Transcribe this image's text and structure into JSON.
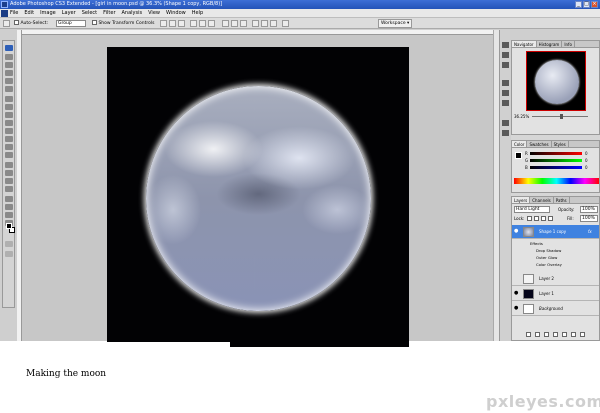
{
  "window": {
    "title": "Adobe Photoshop CS3 Extended - [girl in moon.psd @ 36.3% (Shape 1 copy, RGB/8)]"
  },
  "menu": [
    "File",
    "Edit",
    "Image",
    "Layer",
    "Select",
    "Filter",
    "Analysis",
    "View",
    "Window",
    "Help"
  ],
  "options": {
    "auto_select_label": "Auto-Select:",
    "auto_select_value": "Group",
    "show_transform_label": "Show Transform Controls",
    "workspace_label": "Workspace ▾"
  },
  "navigator": {
    "tabs": [
      "Navigator",
      "Histogram",
      "Info"
    ],
    "zoom": "36.25%"
  },
  "color_panel": {
    "tabs": [
      "Color",
      "Swatches",
      "Styles"
    ],
    "r_value": "0",
    "g_value": "0",
    "b_value": "0",
    "r_label": "R",
    "g_label": "G",
    "b_label": "B"
  },
  "layers_panel": {
    "tabs": [
      "Layers",
      "Channels",
      "Paths"
    ],
    "blend_mode": "Hard Light",
    "opacity_label": "Opacity:",
    "opacity_value": "100%",
    "lock_label": "Lock:",
    "fill_label": "Fill:",
    "fill_value": "100%",
    "layers": [
      {
        "name": "Shape 1 copy",
        "selected": true
      },
      {
        "name": "Layer 2",
        "selected": false
      },
      {
        "name": "Layer 1",
        "selected": false
      },
      {
        "name": "Background",
        "selected": false
      }
    ],
    "effects_label": "Effects",
    "effects": [
      "Drop Shadow",
      "Outer Glow",
      "Color Overlay"
    ],
    "fx_label": "fx"
  },
  "caption": "Making the moon",
  "watermark": "pxleyes.com"
}
